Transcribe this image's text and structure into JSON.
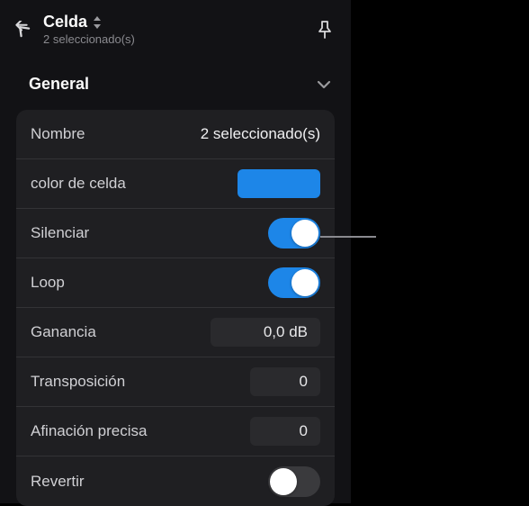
{
  "header": {
    "title": "Celda",
    "subtitle": "2 seleccionado(s)"
  },
  "section": {
    "title": "General"
  },
  "rows": {
    "nombre": {
      "label": "Nombre",
      "value": "2 seleccionado(s)"
    },
    "color": {
      "label": "color de celda",
      "value": "#1d86e8"
    },
    "silenciar": {
      "label": "Silenciar",
      "on": true
    },
    "loop": {
      "label": "Loop",
      "on": true
    },
    "ganancia": {
      "label": "Ganancia",
      "value": "0,0 dB"
    },
    "transposicion": {
      "label": "Transposición",
      "value": "0"
    },
    "afinacion": {
      "label": "Afinación precisa",
      "value": "0"
    },
    "revertir": {
      "label": "Revertir",
      "on": false
    }
  }
}
